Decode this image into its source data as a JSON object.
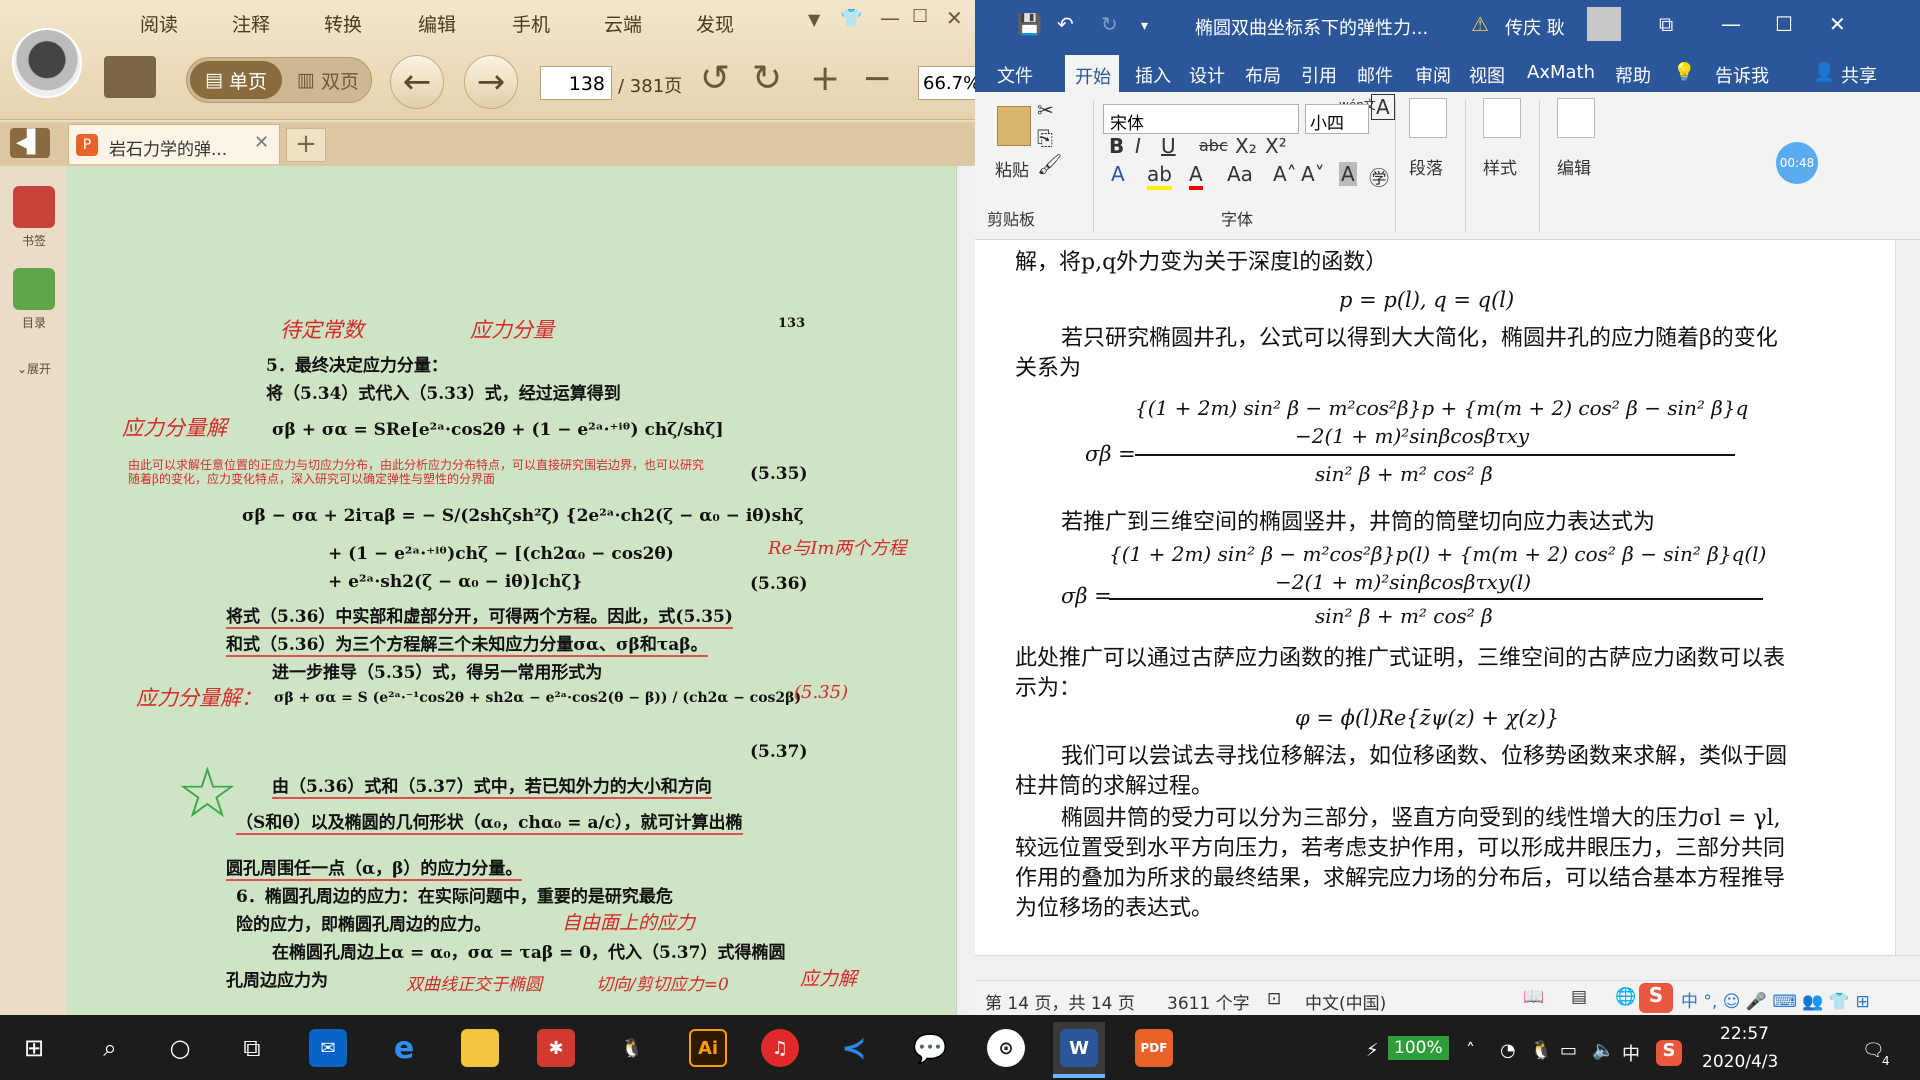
{
  "reader": {
    "menu": [
      "阅读",
      "注释",
      "转换",
      "编辑",
      "手机",
      "云端",
      "发现"
    ],
    "view_single": "单页",
    "view_double": "双页",
    "current_page": "138",
    "total_pages": "/ 381页",
    "zoom": "66.7%",
    "tab_title": "岩石力学的弹...",
    "sidebar": {
      "bookmarks": "书签",
      "toc": "目录",
      "expand": "展开"
    },
    "page_number_mark": "133",
    "lines": {
      "l1": "5．最终决定应力分量：",
      "l2": "将（5.34）式代入（5.33）式，经过运算得到",
      "l3": "σβ + σα = SRe[e²ᵃ·cos2θ + (1 − e²ᵃ·⁺ⁱᶿ) chζ/shζ]",
      "l3_note1": "由此可以求解任意位置的正应力与切应力分布，由此分析应力分布特点，可以直接研究围岩边界，也可以研究",
      "l3_note2": "随着β的变化，应力变化特点，深入研究可以确定弹性与塑性的分界面",
      "l3_num": "(5.35)",
      "l4": "σβ − σα + 2iτaβ = − S/(2shζsh²ζ̄) {2e²ᵃ·ch2(ζ − α₀ − iθ)shζ",
      "l5": "+ (1 − e²ᵃ·⁺ⁱᶿ)chζ − [(ch2α₀ − cos2θ)",
      "l6": "+ e²ᵃ·sh2(ζ − α₀ − iθ)]chζ}",
      "l6_num": "(5.36)",
      "l7": "将式（5.36）中实部和虚部分开，可得两个方程。因此，式(5.35)",
      "l8": "和式（5.36）为三个方程解三个未知应力分量σα、σβ和τaβ。",
      "l9": "进一步推导（5.35）式，得另一常用形式为",
      "l10": "σβ + σα = S (e²ᵃ·⁻¹cos2θ + sh2α − e²ᵃ·cos2(θ − β)) / (ch2α − cos2β)",
      "l10_num": "(5.37)",
      "l11": "由（5.36）式和（5.37）式中，若已知外力的大小和方向",
      "l12": "（S和θ）以及椭圆的几何形状（α₀，chα₀ = a/c），就可计算出椭",
      "l13": "圆孔周围任一点（α，β）的应力分量。",
      "l14": "6．椭圆孔周边的应力：在实际问题中，重要的是研究最危",
      "l15": "险的应力，即椭圆孔周边的应力。",
      "l16": "在椭圆孔周边上α = α₀，σα = τaβ = 0，代入（5.37）式得椭圆",
      "l17": "孔周边应力为"
    },
    "handwriting": {
      "h1": "待定常数",
      "h2": "应力分量",
      "h3": "应力分量解",
      "h4": "Re与Im两个方程",
      "h5": "应力分量解：",
      "h6": "(5.35)",
      "h7": "自由面上的应力",
      "h8": "双曲线正交于椭圆",
      "h9": "切向/剪切应力=0",
      "h10": "应力解"
    }
  },
  "word": {
    "doc_title": "椭圆双曲坐标系下的弹性力...",
    "user": "传庆 耿",
    "ribbon_tabs": [
      "文件",
      "开始",
      "插入",
      "设计",
      "布局",
      "引用",
      "邮件",
      "审阅",
      "视图",
      "AxMath",
      "帮助",
      "告诉我",
      "共享"
    ],
    "font_name": "宋体",
    "font_size": "小四",
    "groups": {
      "paste": "粘贴",
      "clipboard": "剪贴板",
      "font": "字体",
      "paragraph": "段落",
      "styles": "样式",
      "editing": "编辑"
    },
    "timer": "00:48",
    "doc": {
      "p0": "解，将p,q外力变为关于深度l的函数）",
      "eq1": "p = p(l), q = q(l)",
      "p1": "若只研究椭圆井孔，公式可以得到大大简化，椭圆井孔的应力随着β的变化",
      "p1b": "关系为",
      "eq2_num1": "{(1 + 2m) sin² β − m²cos²β}p + {m(m + 2) cos² β − sin² β}q",
      "eq2_num2": "−2(1 + m)²sinβcosβτxy",
      "eq2_den": "sin² β + m² cos² β",
      "eq_lhs": "σβ =",
      "p2": "若推广到三维空间的椭圆竖井，井筒的筒壁切向应力表达式为",
      "eq3_num1": "{(1 + 2m) sin² β − m²cos²β}p(l) + {m(m + 2) cos² β − sin² β}q(l)",
      "eq3_num2": "−2(1 + m)²sinβcosβτxy(l)",
      "eq3_den": "sin² β + m² cos² β",
      "p3": "此处推广可以通过古萨应力函数的推广式证明，三维空间的古萨应力函数可以表",
      "p3b": "示为：",
      "eq4": "φ = ϕ(l)Re{z̄ψ(z) + χ(z)}",
      "p4": "我们可以尝试去寻找位移解法，如位移函数、位移势函数来求解，类似于圆",
      "p4b": "柱井筒的求解过程。",
      "p5": "椭圆井筒的受力可以分为三部分，竖直方向受到的线性增大的压力σl = γl,",
      "p5b": "较远位置受到水平方向压力，若考虑支护作用，可以形成井眼压力，三部分共同",
      "p5c": "作用的叠加为所求的最终结果，求解完应力场的分布后，可以结合基本方程推导",
      "p5d": "为位移场的表达式。"
    },
    "status": {
      "page": "第 14 页，共 14 页",
      "words": "3611 个字",
      "lang": "中文(中国)"
    }
  },
  "taskbar": {
    "battery": "100%",
    "ime": "中",
    "time": "22:57",
    "date": "2020/4/3",
    "notifications": "4"
  },
  "colors": {
    "word_blue": "#2b579a",
    "reader_page": "#cfe4c4",
    "ink_red": "#d42a2a",
    "taskbar": "#1c1c1c"
  }
}
